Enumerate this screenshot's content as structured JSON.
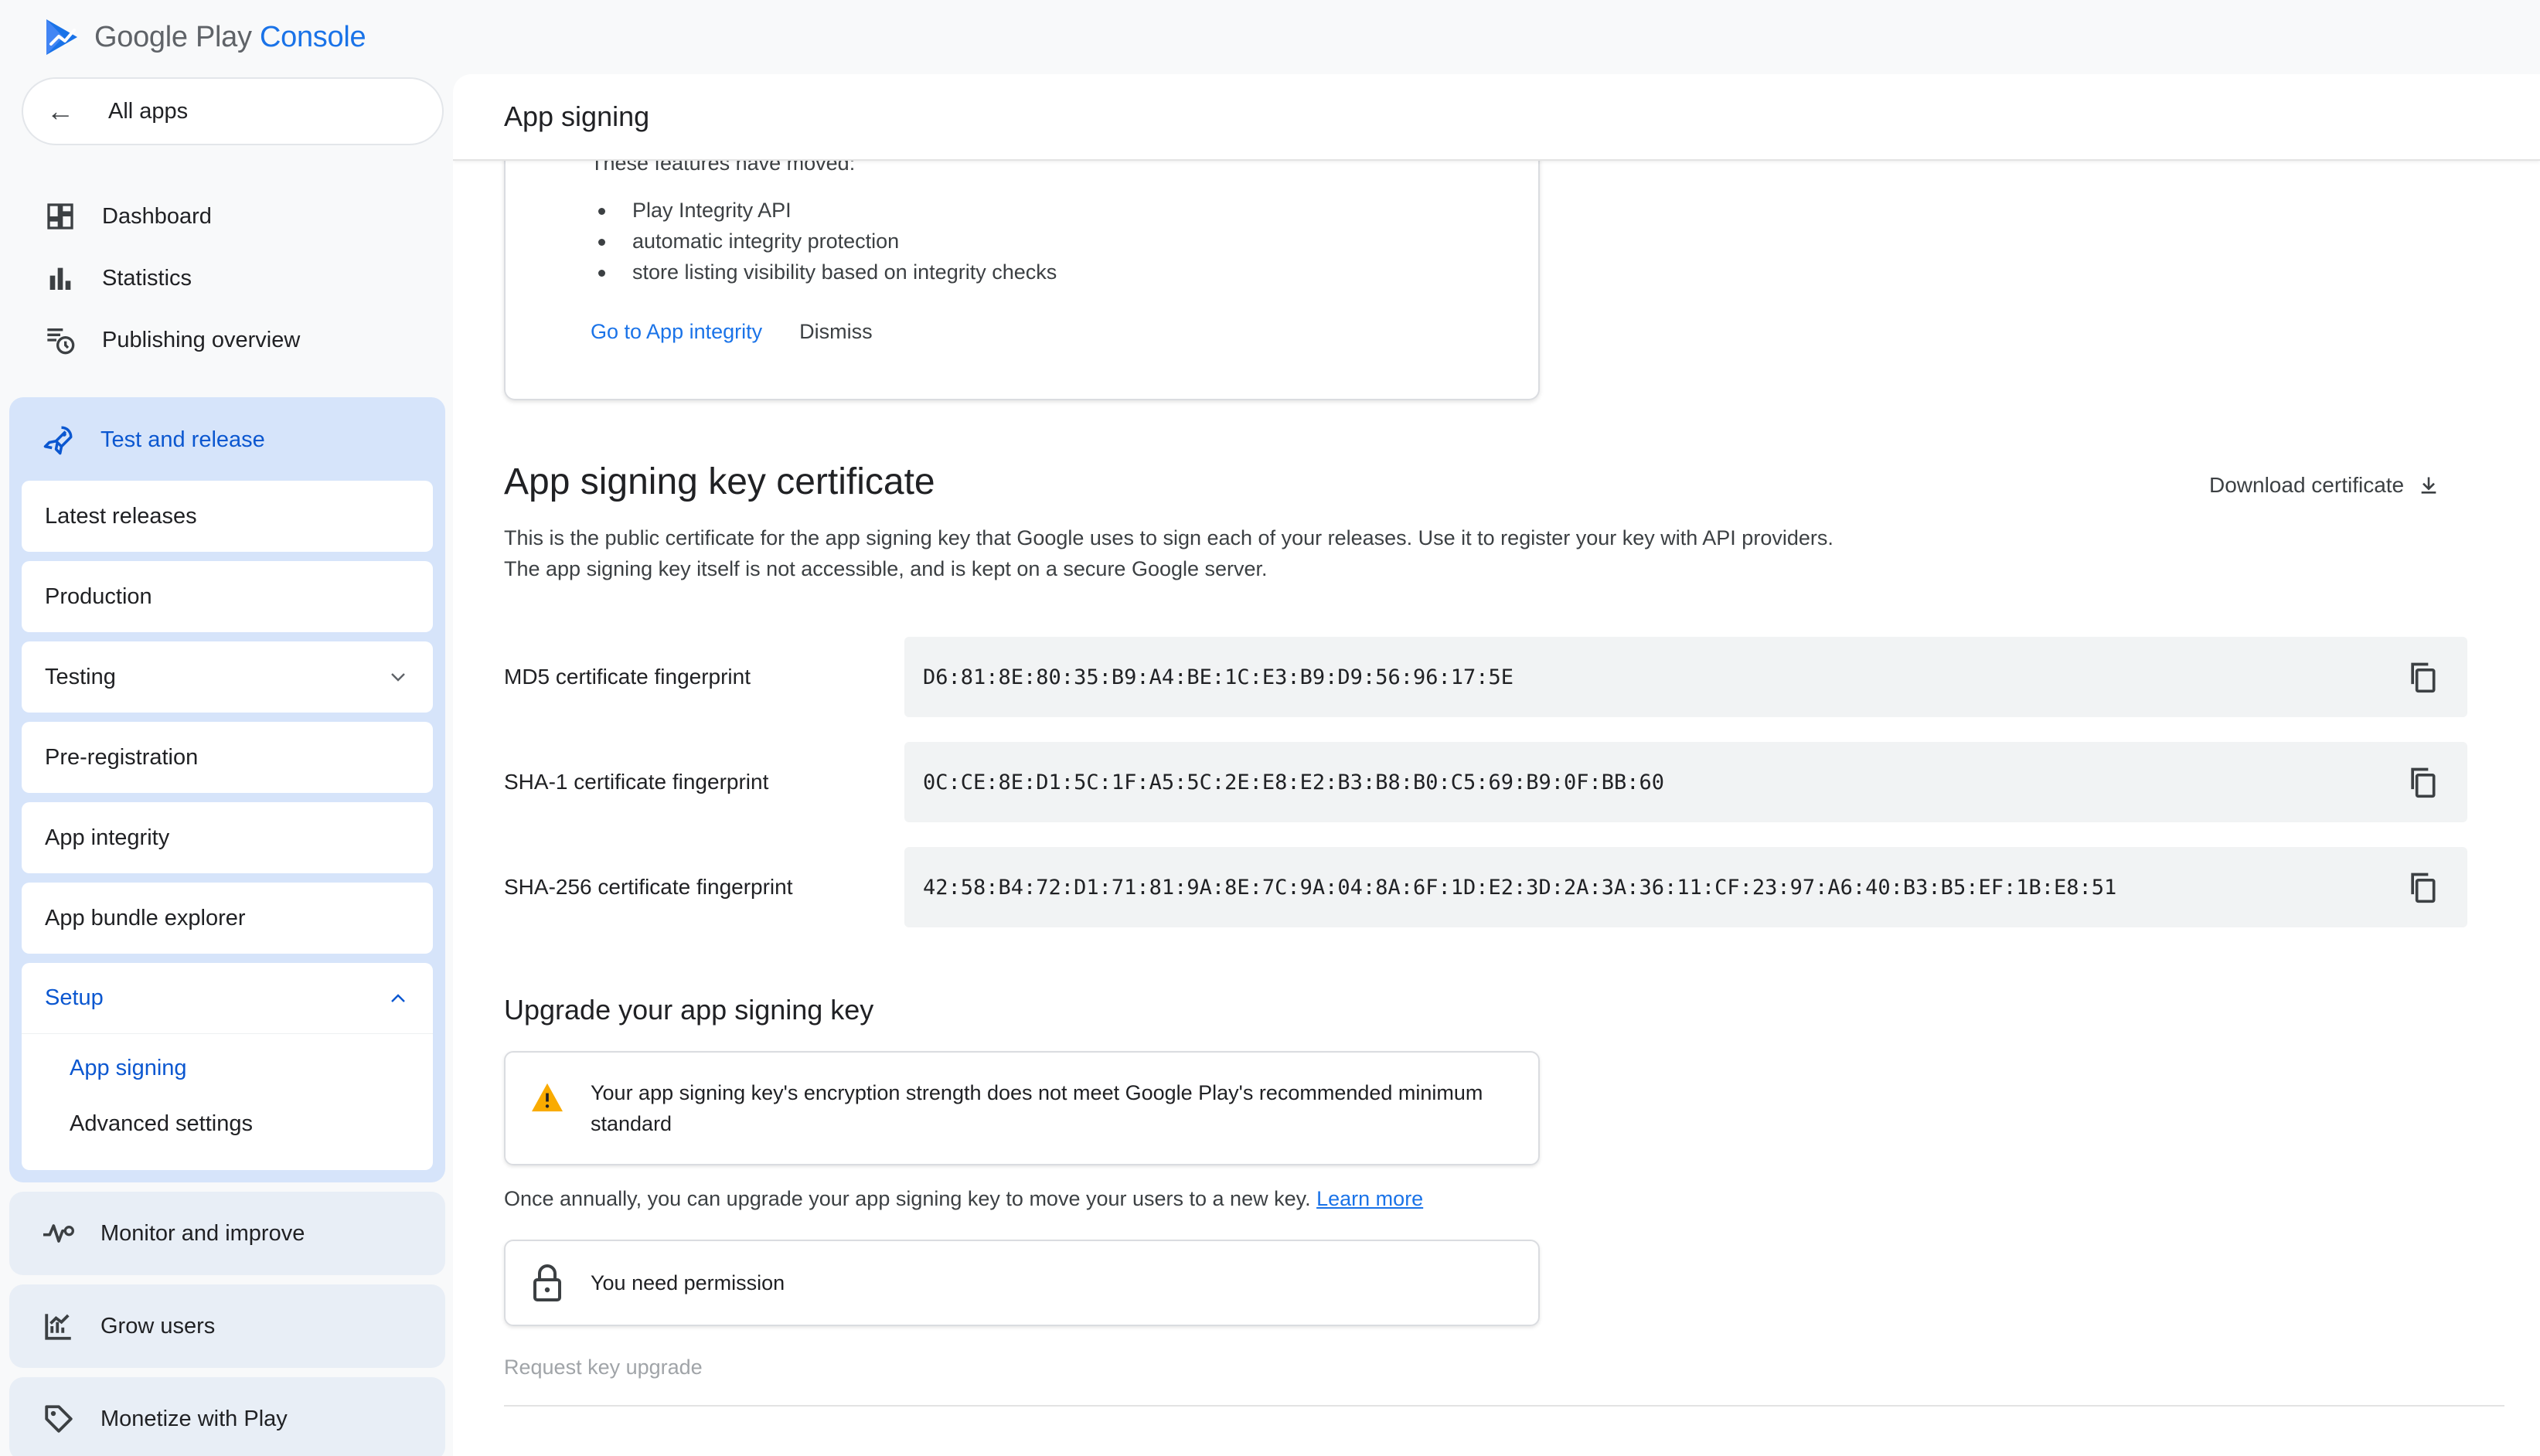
{
  "brand": {
    "name_prefix": "Google Play",
    "name_suffix": "Console",
    "accent": "#1a73e8"
  },
  "sidebar": {
    "all_apps": "All apps",
    "items": [
      {
        "label": "Dashboard",
        "icon": "dashboard-icon"
      },
      {
        "label": "Statistics",
        "icon": "bar-chart-icon"
      },
      {
        "label": "Publishing overview",
        "icon": "publishing-overview-icon"
      }
    ],
    "test_release": {
      "label": "Test and release",
      "icon": "rocket-icon",
      "cards": [
        {
          "label": "Latest releases"
        },
        {
          "label": "Production"
        },
        {
          "label": "Testing",
          "has_chevron": true
        },
        {
          "label": "Pre-registration"
        },
        {
          "label": "App integrity"
        },
        {
          "label": "App bundle explorer"
        }
      ],
      "setup": {
        "label": "Setup",
        "items": [
          {
            "label": "App signing",
            "selected": true
          },
          {
            "label": "Advanced settings"
          }
        ]
      }
    },
    "groups": [
      {
        "label": "Monitor and improve",
        "icon": "monitor-icon"
      },
      {
        "label": "Grow users",
        "icon": "grow-users-icon"
      },
      {
        "label": "Monetize with Play",
        "icon": "tag-icon"
      }
    ]
  },
  "main": {
    "page_title": "App signing",
    "notice": {
      "intro": "These features have moved:",
      "items": [
        "Play Integrity API",
        "automatic integrity protection",
        "store listing visibility based on integrity checks"
      ],
      "primary_action": "Go to App integrity",
      "secondary_action": "Dismiss"
    },
    "certificate": {
      "title": "App signing key certificate",
      "download_label": "Download certificate",
      "description": "This is the public certificate for the app signing key that Google uses to sign each of your releases. Use it to register your key with API providers. The app signing key itself is not accessible, and is kept on a secure Google server.",
      "fingerprints": [
        {
          "label": "MD5 certificate fingerprint",
          "value": "D6:81:8E:80:35:B9:A4:BE:1C:E3:B9:D9:56:96:17:5E"
        },
        {
          "label": "SHA-1 certificate fingerprint",
          "value": "0C:CE:8E:D1:5C:1F:A5:5C:2E:E8:E2:B3:B8:B0:C5:69:B9:0F:BB:60"
        },
        {
          "label": "SHA-256 certificate fingerprint",
          "value": "42:58:B4:72:D1:71:81:9A:8E:7C:9A:04:8A:6F:1D:E2:3D:2A:3A:36:11:CF:23:97:A6:40:B3:B5:EF:1B:E8:51"
        }
      ]
    },
    "upgrade": {
      "title": "Upgrade your app signing key",
      "warning": "Your app signing key's encryption strength does not meet Google Play's recommended minimum standard",
      "annual_text": "Once annually, you can upgrade your app signing key to move your users to a new key.",
      "learn_more": "Learn more",
      "permission": "You need permission",
      "request_label": "Request key upgrade"
    }
  }
}
